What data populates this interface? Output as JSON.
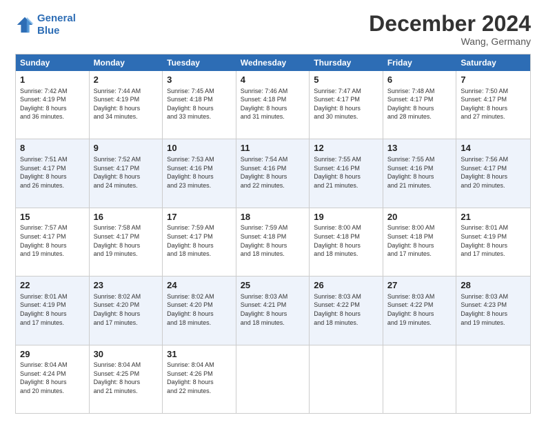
{
  "header": {
    "logo_line1": "General",
    "logo_line2": "Blue",
    "month_title": "December 2024",
    "location": "Wang, Germany"
  },
  "weekdays": [
    "Sunday",
    "Monday",
    "Tuesday",
    "Wednesday",
    "Thursday",
    "Friday",
    "Saturday"
  ],
  "rows": [
    [
      {
        "day": "1",
        "lines": [
          "Sunrise: 7:42 AM",
          "Sunset: 4:19 PM",
          "Daylight: 8 hours",
          "and 36 minutes."
        ]
      },
      {
        "day": "2",
        "lines": [
          "Sunrise: 7:44 AM",
          "Sunset: 4:19 PM",
          "Daylight: 8 hours",
          "and 34 minutes."
        ]
      },
      {
        "day": "3",
        "lines": [
          "Sunrise: 7:45 AM",
          "Sunset: 4:18 PM",
          "Daylight: 8 hours",
          "and 33 minutes."
        ]
      },
      {
        "day": "4",
        "lines": [
          "Sunrise: 7:46 AM",
          "Sunset: 4:18 PM",
          "Daylight: 8 hours",
          "and 31 minutes."
        ]
      },
      {
        "day": "5",
        "lines": [
          "Sunrise: 7:47 AM",
          "Sunset: 4:17 PM",
          "Daylight: 8 hours",
          "and 30 minutes."
        ]
      },
      {
        "day": "6",
        "lines": [
          "Sunrise: 7:48 AM",
          "Sunset: 4:17 PM",
          "Daylight: 8 hours",
          "and 28 minutes."
        ]
      },
      {
        "day": "7",
        "lines": [
          "Sunrise: 7:50 AM",
          "Sunset: 4:17 PM",
          "Daylight: 8 hours",
          "and 27 minutes."
        ]
      }
    ],
    [
      {
        "day": "8",
        "lines": [
          "Sunrise: 7:51 AM",
          "Sunset: 4:17 PM",
          "Daylight: 8 hours",
          "and 26 minutes."
        ]
      },
      {
        "day": "9",
        "lines": [
          "Sunrise: 7:52 AM",
          "Sunset: 4:17 PM",
          "Daylight: 8 hours",
          "and 24 minutes."
        ]
      },
      {
        "day": "10",
        "lines": [
          "Sunrise: 7:53 AM",
          "Sunset: 4:16 PM",
          "Daylight: 8 hours",
          "and 23 minutes."
        ]
      },
      {
        "day": "11",
        "lines": [
          "Sunrise: 7:54 AM",
          "Sunset: 4:16 PM",
          "Daylight: 8 hours",
          "and 22 minutes."
        ]
      },
      {
        "day": "12",
        "lines": [
          "Sunrise: 7:55 AM",
          "Sunset: 4:16 PM",
          "Daylight: 8 hours",
          "and 21 minutes."
        ]
      },
      {
        "day": "13",
        "lines": [
          "Sunrise: 7:55 AM",
          "Sunset: 4:16 PM",
          "Daylight: 8 hours",
          "and 21 minutes."
        ]
      },
      {
        "day": "14",
        "lines": [
          "Sunrise: 7:56 AM",
          "Sunset: 4:17 PM",
          "Daylight: 8 hours",
          "and 20 minutes."
        ]
      }
    ],
    [
      {
        "day": "15",
        "lines": [
          "Sunrise: 7:57 AM",
          "Sunset: 4:17 PM",
          "Daylight: 8 hours",
          "and 19 minutes."
        ]
      },
      {
        "day": "16",
        "lines": [
          "Sunrise: 7:58 AM",
          "Sunset: 4:17 PM",
          "Daylight: 8 hours",
          "and 19 minutes."
        ]
      },
      {
        "day": "17",
        "lines": [
          "Sunrise: 7:59 AM",
          "Sunset: 4:17 PM",
          "Daylight: 8 hours",
          "and 18 minutes."
        ]
      },
      {
        "day": "18",
        "lines": [
          "Sunrise: 7:59 AM",
          "Sunset: 4:18 PM",
          "Daylight: 8 hours",
          "and 18 minutes."
        ]
      },
      {
        "day": "19",
        "lines": [
          "Sunrise: 8:00 AM",
          "Sunset: 4:18 PM",
          "Daylight: 8 hours",
          "and 18 minutes."
        ]
      },
      {
        "day": "20",
        "lines": [
          "Sunrise: 8:00 AM",
          "Sunset: 4:18 PM",
          "Daylight: 8 hours",
          "and 17 minutes."
        ]
      },
      {
        "day": "21",
        "lines": [
          "Sunrise: 8:01 AM",
          "Sunset: 4:19 PM",
          "Daylight: 8 hours",
          "and 17 minutes."
        ]
      }
    ],
    [
      {
        "day": "22",
        "lines": [
          "Sunrise: 8:01 AM",
          "Sunset: 4:19 PM",
          "Daylight: 8 hours",
          "and 17 minutes."
        ]
      },
      {
        "day": "23",
        "lines": [
          "Sunrise: 8:02 AM",
          "Sunset: 4:20 PM",
          "Daylight: 8 hours",
          "and 17 minutes."
        ]
      },
      {
        "day": "24",
        "lines": [
          "Sunrise: 8:02 AM",
          "Sunset: 4:20 PM",
          "Daylight: 8 hours",
          "and 18 minutes."
        ]
      },
      {
        "day": "25",
        "lines": [
          "Sunrise: 8:03 AM",
          "Sunset: 4:21 PM",
          "Daylight: 8 hours",
          "and 18 minutes."
        ]
      },
      {
        "day": "26",
        "lines": [
          "Sunrise: 8:03 AM",
          "Sunset: 4:22 PM",
          "Daylight: 8 hours",
          "and 18 minutes."
        ]
      },
      {
        "day": "27",
        "lines": [
          "Sunrise: 8:03 AM",
          "Sunset: 4:22 PM",
          "Daylight: 8 hours",
          "and 19 minutes."
        ]
      },
      {
        "day": "28",
        "lines": [
          "Sunrise: 8:03 AM",
          "Sunset: 4:23 PM",
          "Daylight: 8 hours",
          "and 19 minutes."
        ]
      }
    ],
    [
      {
        "day": "29",
        "lines": [
          "Sunrise: 8:04 AM",
          "Sunset: 4:24 PM",
          "Daylight: 8 hours",
          "and 20 minutes."
        ]
      },
      {
        "day": "30",
        "lines": [
          "Sunrise: 8:04 AM",
          "Sunset: 4:25 PM",
          "Daylight: 8 hours",
          "and 21 minutes."
        ]
      },
      {
        "day": "31",
        "lines": [
          "Sunrise: 8:04 AM",
          "Sunset: 4:26 PM",
          "Daylight: 8 hours",
          "and 22 minutes."
        ]
      },
      {
        "day": "",
        "lines": []
      },
      {
        "day": "",
        "lines": []
      },
      {
        "day": "",
        "lines": []
      },
      {
        "day": "",
        "lines": []
      }
    ]
  ]
}
